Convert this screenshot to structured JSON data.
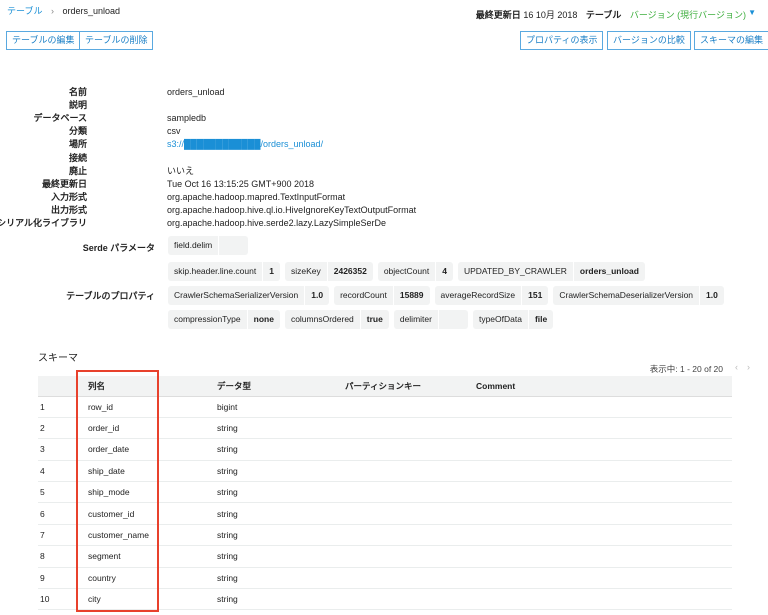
{
  "breadcrumb": {
    "parent": "テーブル",
    "separator": "›",
    "current": "orders_unload"
  },
  "header": {
    "last_updated_label": "最終更新日",
    "last_updated_value": "16 10月 2018",
    "table_label": "テーブル",
    "version_select": "バージョン (現行バージョン)"
  },
  "buttons": {
    "edit_table": "テーブルの編集",
    "delete_table": "テーブルの削除",
    "view_properties": "プロパティの表示",
    "compare_versions": "バージョンの比較",
    "edit_schema": "スキーマの編集"
  },
  "details": [
    {
      "label": "名前",
      "value": "orders_unload"
    },
    {
      "label": "説明",
      "value": ""
    },
    {
      "label": "データベース",
      "value": "sampledb"
    },
    {
      "label": "分類",
      "value": "csv"
    },
    {
      "label": "場所",
      "value": "s3://████████████/orders_unload/",
      "link": true
    },
    {
      "label": "接続",
      "value": ""
    },
    {
      "label": "廃止",
      "value": "いいえ"
    },
    {
      "label": "最終更新日",
      "value": "Tue Oct 16 13:15:25 GMT+900 2018"
    },
    {
      "label": "入力形式",
      "value": "org.apache.hadoop.mapred.TextInputFormat"
    },
    {
      "label": "出力形式",
      "value": "org.apache.hadoop.hive.ql.io.HiveIgnoreKeyTextOutputFormat"
    },
    {
      "label": "Serde シリアル化ライブラリ",
      "value": "org.apache.hadoop.hive.serde2.lazy.LazySimpleSerDe"
    }
  ],
  "serde_params": {
    "label": "Serde パラメータ",
    "items": [
      {
        "k": "field.delim",
        "v": ""
      }
    ]
  },
  "table_properties": {
    "label": "テーブルのプロパティ",
    "rows": [
      [
        {
          "k": "skip.header.line.count",
          "v": "1"
        },
        {
          "k": "sizeKey",
          "v": "2426352"
        },
        {
          "k": "objectCount",
          "v": "4"
        },
        {
          "k": "UPDATED_BY_CRAWLER",
          "v": "orders_unload"
        }
      ],
      [
        {
          "k": "CrawlerSchemaSerializerVersion",
          "v": "1.0"
        },
        {
          "k": "recordCount",
          "v": "15889"
        },
        {
          "k": "averageRecordSize",
          "v": "151"
        },
        {
          "k": "CrawlerSchemaDeserializerVersion",
          "v": "1.0"
        }
      ],
      [
        {
          "k": "compressionType",
          "v": "none"
        },
        {
          "k": "columnsOrdered",
          "v": "true"
        },
        {
          "k": "delimiter",
          "v": ""
        },
        {
          "k": "typeOfData",
          "v": "file"
        }
      ]
    ]
  },
  "schema": {
    "title": "スキーマ",
    "pagination": "表示中: 1 - 20 of 20",
    "columns": [
      "",
      "列名",
      "データ型",
      "パーティションキー",
      "Comment"
    ],
    "rows": [
      [
        "1",
        "row_id",
        "bigint"
      ],
      [
        "2",
        "order_id",
        "string"
      ],
      [
        "3",
        "order_date",
        "string"
      ],
      [
        "4",
        "ship_date",
        "string"
      ],
      [
        "5",
        "ship_mode",
        "string"
      ],
      [
        "6",
        "customer_id",
        "string"
      ],
      [
        "7",
        "customer_name",
        "string"
      ],
      [
        "8",
        "segment",
        "string"
      ],
      [
        "9",
        "country",
        "string"
      ],
      [
        "10",
        "city",
        "string"
      ]
    ]
  },
  "colors": {
    "accent": "#1a8fd6",
    "version_green": "#3cae3c",
    "highlight": "#e8412c"
  }
}
